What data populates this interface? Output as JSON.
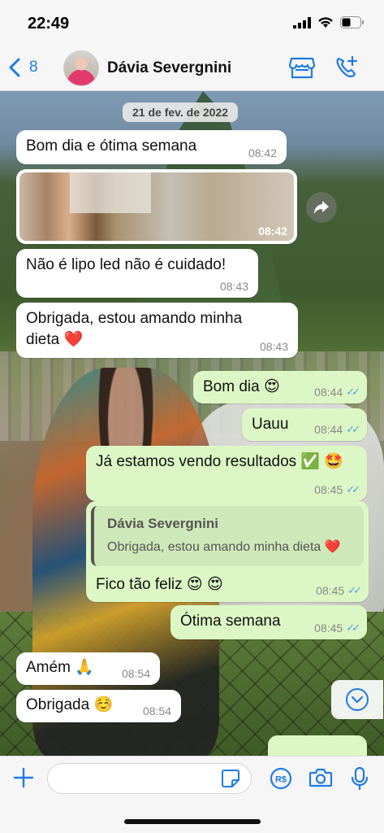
{
  "status_bar": {
    "time": "22:49"
  },
  "header": {
    "back_count": "8",
    "contact_name": "Dávia Severgnini"
  },
  "chat": {
    "date_label": "21 de fev. de 2022",
    "messages": [
      {
        "text": "Bom dia e ótima semana",
        "time": "08:42"
      },
      {
        "image_time": "08:42"
      },
      {
        "text": "Não é lipo led não é cuidado!",
        "time": "08:43"
      },
      {
        "text": "Obrigada, estou amando minha dieta ❤️",
        "time": "08:43"
      },
      {
        "text": "Bom dia 😍",
        "time": "08:44"
      },
      {
        "text": "Uauu",
        "time": "08:44"
      },
      {
        "text": "Já estamos vendo resultados ✅ 🤩",
        "time": "08:45"
      },
      {
        "quote_author": "Dávia Severgnini",
        "quote_text": "Obrigada, estou amando minha dieta ❤️",
        "text": "Fico tão feliz 😍 😍",
        "time": "08:45"
      },
      {
        "text": "Ótima semana",
        "time": "08:45"
      },
      {
        "text": "Amém 🙏",
        "time": "08:54"
      },
      {
        "text": "Obrigada ☺️",
        "time": "08:54"
      }
    ]
  },
  "composer": {
    "placeholder": ""
  },
  "icons": {
    "back": "chevron-left-icon",
    "store": "storefront-icon",
    "call": "add-call-icon",
    "forward": "forward-icon",
    "scroll_down": "chevron-down-icon",
    "plus": "plus-icon",
    "sticker": "sticker-icon",
    "payment": "payment-icon",
    "camera": "camera-icon",
    "mic": "microphone-icon"
  },
  "colors": {
    "accent": "#1f7ae6",
    "outgoing_bubble": "#dcf7c5",
    "incoming_bubble": "#ffffff",
    "read_ticks": "#4fa3e8"
  }
}
